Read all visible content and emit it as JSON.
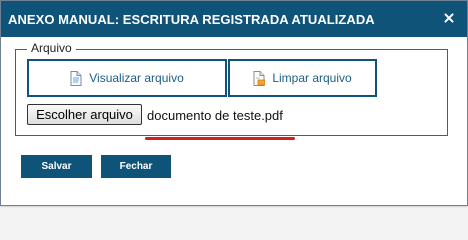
{
  "dialog": {
    "title": "ANEXO MANUAL: ESCRITURA REGISTRADA ATUALIZADA",
    "close_icon": "close-icon"
  },
  "arquivo": {
    "legend": "Arquivo",
    "view_button": {
      "label": "Visualizar arquivo",
      "icon": "document-icon"
    },
    "clear_button": {
      "label": "Limpar arquivo",
      "icon": "clear-document-icon"
    },
    "file_input": {
      "button_label": "Escolher arquivo",
      "selected_file": "documento de  teste.pdf"
    }
  },
  "footer": {
    "save_label": "Salvar",
    "close_label": "Fechar"
  },
  "colors": {
    "titlebar": "#0f5379",
    "button_border": "#0f5379",
    "highlight_underline": "#d51f1f"
  }
}
